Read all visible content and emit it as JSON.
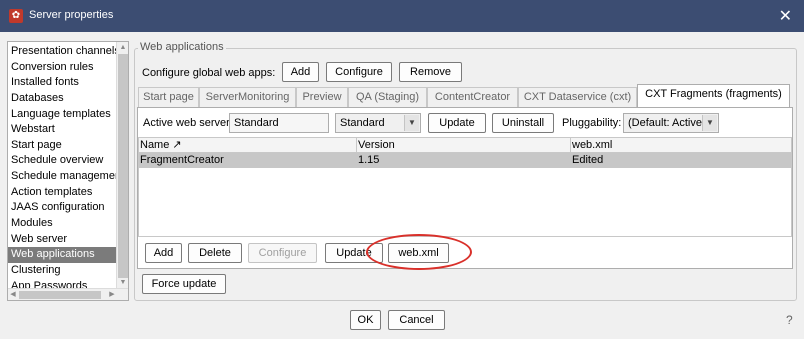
{
  "window": {
    "title": "Server properties",
    "close_glyph": "✕",
    "icon": "gear-icon"
  },
  "sidebar": {
    "items": [
      {
        "label": "Presentation channels",
        "selected": false
      },
      {
        "label": "Conversion rules",
        "selected": false
      },
      {
        "label": "Installed fonts",
        "selected": false
      },
      {
        "label": "Databases",
        "selected": false
      },
      {
        "label": "Language templates",
        "selected": false
      },
      {
        "label": "Webstart",
        "selected": false
      },
      {
        "label": "Start page",
        "selected": false
      },
      {
        "label": "Schedule overview",
        "selected": false
      },
      {
        "label": "Schedule management",
        "selected": false
      },
      {
        "label": "Action templates",
        "selected": false
      },
      {
        "label": "JAAS configuration",
        "selected": false
      },
      {
        "label": "Modules",
        "selected": false
      },
      {
        "label": "Web server",
        "selected": false
      },
      {
        "label": "Web applications",
        "selected": true
      },
      {
        "label": "Clustering",
        "selected": false
      },
      {
        "label": "App Passwords",
        "selected": false
      }
    ]
  },
  "web_apps": {
    "group_title": "Web applications",
    "configure_label": "Configure global web apps:",
    "add_label": "Add",
    "configure_btn_label": "Configure",
    "remove_label": "Remove"
  },
  "tabs": [
    {
      "label": "Start page",
      "active": false
    },
    {
      "label": "ServerMonitoring",
      "active": false
    },
    {
      "label": "Preview",
      "active": false
    },
    {
      "label": "QA (Staging)",
      "active": false
    },
    {
      "label": "ContentCreator",
      "active": false
    },
    {
      "label": "CXT Dataservice (cxt)",
      "active": false
    },
    {
      "label": "CXT Fragments (fragments)",
      "active": true
    }
  ],
  "server_row": {
    "active_web_server_label": "Active web server:",
    "active_web_server_value": "Standard",
    "server_select_value": "Standard",
    "update_label": "Update",
    "uninstall_label": "Uninstall",
    "pluggability_label": "Pluggability:",
    "pluggability_value": "(Default: Active)"
  },
  "table": {
    "columns": [
      "Name ↗",
      "Version",
      "web.xml"
    ],
    "rows": [
      {
        "name": "FragmentCreator",
        "version": "1.15",
        "webxml": "Edited",
        "selected": true
      }
    ]
  },
  "actions": {
    "add_label": "Add",
    "delete_label": "Delete",
    "configure_label": "Configure",
    "update_label": "Update",
    "webxml_label": "web.xml",
    "force_update_label": "Force update"
  },
  "footer": {
    "ok_label": "OK",
    "cancel_label": "Cancel",
    "help_glyph": "?"
  },
  "colors": {
    "titlebar": "#3c4d72",
    "selection": "#7b7b7b",
    "row_highlight": "#c7c7c7",
    "annotation": "#d9302a"
  }
}
